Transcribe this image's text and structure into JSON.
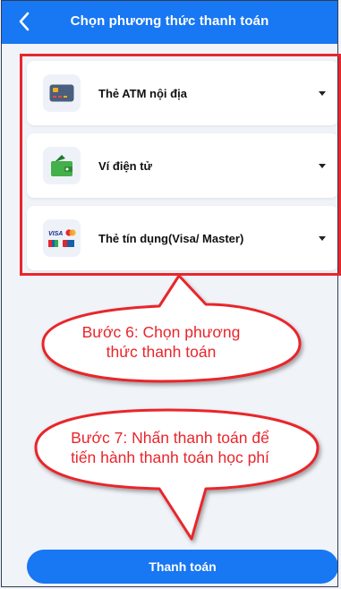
{
  "header": {
    "title": "Chọn phương thức thanh toán"
  },
  "payment_methods": [
    {
      "label": "Thẻ ATM nội địa",
      "icon": "atm-card-icon"
    },
    {
      "label": "Ví điện tử",
      "icon": "wallet-icon"
    },
    {
      "label": "Thẻ tín dụng(Visa/ Master)",
      "icon": "credit-card-brands-icon"
    }
  ],
  "callouts": {
    "step6_line1": "Bước 6: Chọn phương",
    "step6_line2": "thức thanh toán",
    "step7_line1": "Bước 7: Nhấn thanh toán để",
    "step7_line2": "tiến hành thanh toán học phí"
  },
  "footer": {
    "pay_label": "Thanh toán"
  },
  "colors": {
    "primary": "#1877f2",
    "annotation": "#e8262c",
    "background": "#f0f3f8"
  }
}
